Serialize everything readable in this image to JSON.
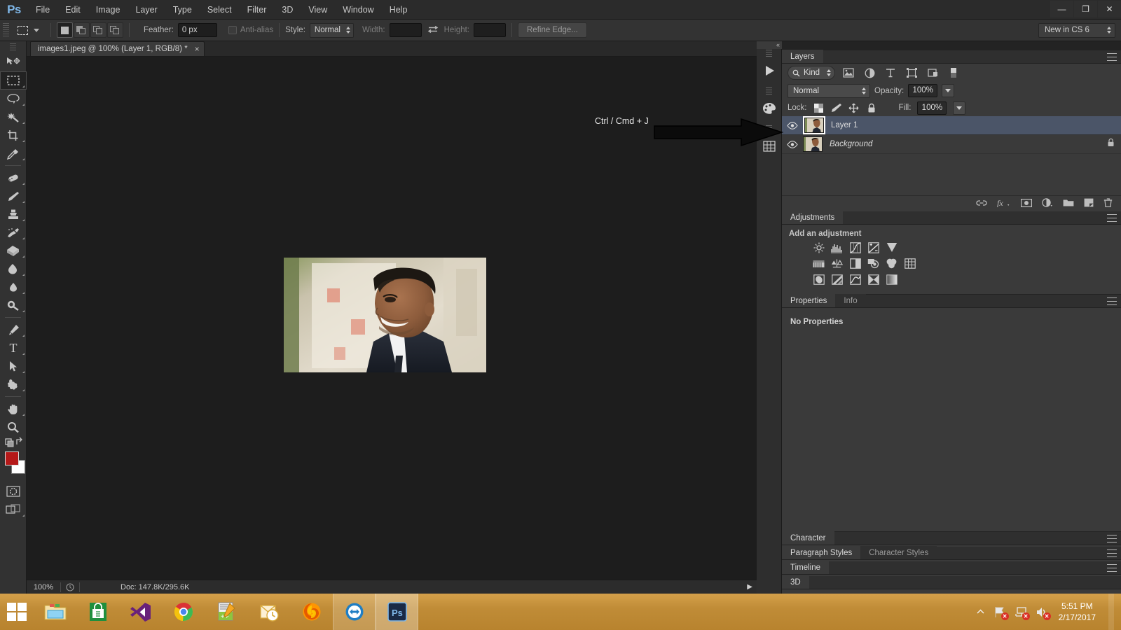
{
  "app": {
    "name": "Adobe Photoshop CS6",
    "logo_text": "Ps"
  },
  "menubar": {
    "items": [
      {
        "label": "File"
      },
      {
        "label": "Edit"
      },
      {
        "label": "Image"
      },
      {
        "label": "Layer"
      },
      {
        "label": "Type"
      },
      {
        "label": "Select"
      },
      {
        "label": "Filter"
      },
      {
        "label": "3D"
      },
      {
        "label": "View"
      },
      {
        "label": "Window"
      },
      {
        "label": "Help"
      }
    ]
  },
  "window_controls": {
    "minimize": "—",
    "restore": "❐",
    "close": "✕"
  },
  "options_bar": {
    "feather_label": "Feather:",
    "feather_value": "0 px",
    "antialias_label": "Anti-alias",
    "style_label": "Style:",
    "style_value": "Normal",
    "width_label": "Width:",
    "width_value": "",
    "height_label": "Height:",
    "height_value": "",
    "swap_icon": "swap-dimensions-icon",
    "refine_edge_label": "Refine Edge...",
    "workspace_value": "New in CS 6"
  },
  "toolbar": {
    "tools_upper": [
      {
        "name": "move-tool",
        "selected": false
      },
      {
        "name": "rectangular-marquee-tool",
        "selected": true
      },
      {
        "name": "lasso-tool",
        "selected": false
      },
      {
        "name": "quick-selection-tool",
        "selected": false
      },
      {
        "name": "crop-tool",
        "selected": false
      },
      {
        "name": "eyedropper-tool",
        "selected": false
      }
    ],
    "tools_mid": [
      {
        "name": "spot-healing-brush-tool",
        "selected": false
      },
      {
        "name": "brush-tool",
        "selected": false
      },
      {
        "name": "clone-stamp-tool",
        "selected": false
      },
      {
        "name": "history-brush-tool",
        "selected": false
      },
      {
        "name": "eraser-tool",
        "selected": false
      },
      {
        "name": "gradient-tool",
        "selected": false
      },
      {
        "name": "blur-tool",
        "selected": false
      },
      {
        "name": "dodge-tool",
        "selected": false
      }
    ],
    "tools_lower": [
      {
        "name": "pen-tool",
        "selected": false
      },
      {
        "name": "horizontal-type-tool",
        "selected": false,
        "glyph": "T"
      },
      {
        "name": "path-selection-tool",
        "selected": false
      },
      {
        "name": "custom-shape-tool",
        "selected": false
      }
    ],
    "tools_nav": [
      {
        "name": "hand-tool",
        "selected": false
      },
      {
        "name": "zoom-tool",
        "selected": false
      }
    ],
    "foreground_color": "#b51919",
    "background_color": "#ffffff",
    "quick_mask_name": "quick-mask-mode-button",
    "screen_mode_name": "screen-mode-button"
  },
  "document": {
    "tab_title": "images1.jpeg @ 100% (Layer 1, RGB/8) *",
    "close_glyph": "×"
  },
  "status_bar": {
    "zoom": "100%",
    "doc_info": "Doc: 147.8K/295.6K",
    "arrow_glyph": "▶"
  },
  "annotation": {
    "text": "Ctrl / Cmd + J",
    "arrow_name": "pointer-arrow-annotation"
  },
  "panels": {
    "layers": {
      "tab_label": "Layers",
      "filter_kind_label": "Kind",
      "filter_icons": [
        "filter-pixel-layers-icon",
        "filter-adjustment-layers-icon",
        "filter-type-layers-icon",
        "filter-shape-layers-icon",
        "filter-smart-object-icon",
        "filter-toggle-icon"
      ],
      "blend_mode": "Normal",
      "opacity_label": "Opacity:",
      "opacity_value": "100%",
      "lock_label": "Lock:",
      "lock_icons": [
        "lock-transparent-pixels-icon",
        "lock-image-pixels-icon",
        "lock-position-icon",
        "lock-all-icon"
      ],
      "fill_label": "Fill:",
      "fill_value": "100%",
      "rows": [
        {
          "name": "Layer 1",
          "selected": true,
          "visible": true,
          "locked": false,
          "italic": false
        },
        {
          "name": "Background",
          "selected": false,
          "visible": true,
          "locked": true,
          "italic": true
        }
      ],
      "footer_icons": [
        "link-layers-icon",
        "layer-styles-fx-icon",
        "add-layer-mask-icon",
        "new-fill-adjustment-layer-icon",
        "new-group-icon",
        "new-layer-icon",
        "delete-layer-icon"
      ]
    },
    "adjustments": {
      "tab_label": "Adjustments",
      "heading": "Add an adjustment",
      "row1": [
        "brightness-contrast-icon",
        "levels-icon",
        "curves-icon",
        "exposure-icon",
        "vibrance-icon"
      ],
      "row2": [
        "hue-saturation-icon",
        "color-balance-icon",
        "black-white-icon",
        "photo-filter-icon",
        "channel-mixer-icon",
        "color-lookup-icon"
      ],
      "row3": [
        "invert-icon",
        "posterize-icon",
        "threshold-icon",
        "selective-color-icon",
        "gradient-map-icon"
      ]
    },
    "properties": {
      "tabs": [
        {
          "label": "Properties",
          "active": true
        },
        {
          "label": "Info",
          "active": false
        }
      ],
      "empty_text": "No Properties"
    },
    "character": {
      "tabs": [
        {
          "label": "Character",
          "active": true
        }
      ]
    },
    "paragraph_styles": {
      "tabs": [
        {
          "label": "Paragraph Styles",
          "active": true
        },
        {
          "label": "Character Styles",
          "active": false
        }
      ]
    },
    "timeline": {
      "tabs": [
        {
          "label": "Timeline",
          "active": true
        }
      ]
    },
    "three_d": {
      "tabs": [
        {
          "label": "3D",
          "active": true
        }
      ]
    }
  },
  "dock_strip": {
    "items": [
      "timeline-play-icon",
      "color-swatches-icon",
      "histogram-icon"
    ],
    "collapse_glyph": "«"
  },
  "taskbar": {
    "start_name": "windows-start-button",
    "apps": [
      {
        "name": "file-explorer-taskbar-icon",
        "running": false
      },
      {
        "name": "windows-store-taskbar-icon",
        "running": false
      },
      {
        "name": "visual-studio-taskbar-icon",
        "running": false
      },
      {
        "name": "google-chrome-taskbar-icon",
        "running": false
      },
      {
        "name": "notepad-plus-plus-taskbar-icon",
        "running": false
      },
      {
        "name": "microsoft-outlook-taskbar-icon",
        "running": false
      },
      {
        "name": "mozilla-firefox-taskbar-icon",
        "running": false
      },
      {
        "name": "teamviewer-taskbar-icon",
        "running": true
      },
      {
        "name": "photoshop-taskbar-icon",
        "running": true,
        "active": true
      }
    ],
    "tray": {
      "expand_glyph": "▲",
      "icons": [
        "action-center-flag-icon",
        "network-icon",
        "volume-muted-icon"
      ],
      "time": "5:51 PM",
      "date": "2/17/2017"
    }
  },
  "colors": {
    "accent_selection": "#4b5568",
    "panel_bg": "#3a3a3a",
    "canvas_bg": "#1d1d1d",
    "taskbar": "#c08c37"
  }
}
